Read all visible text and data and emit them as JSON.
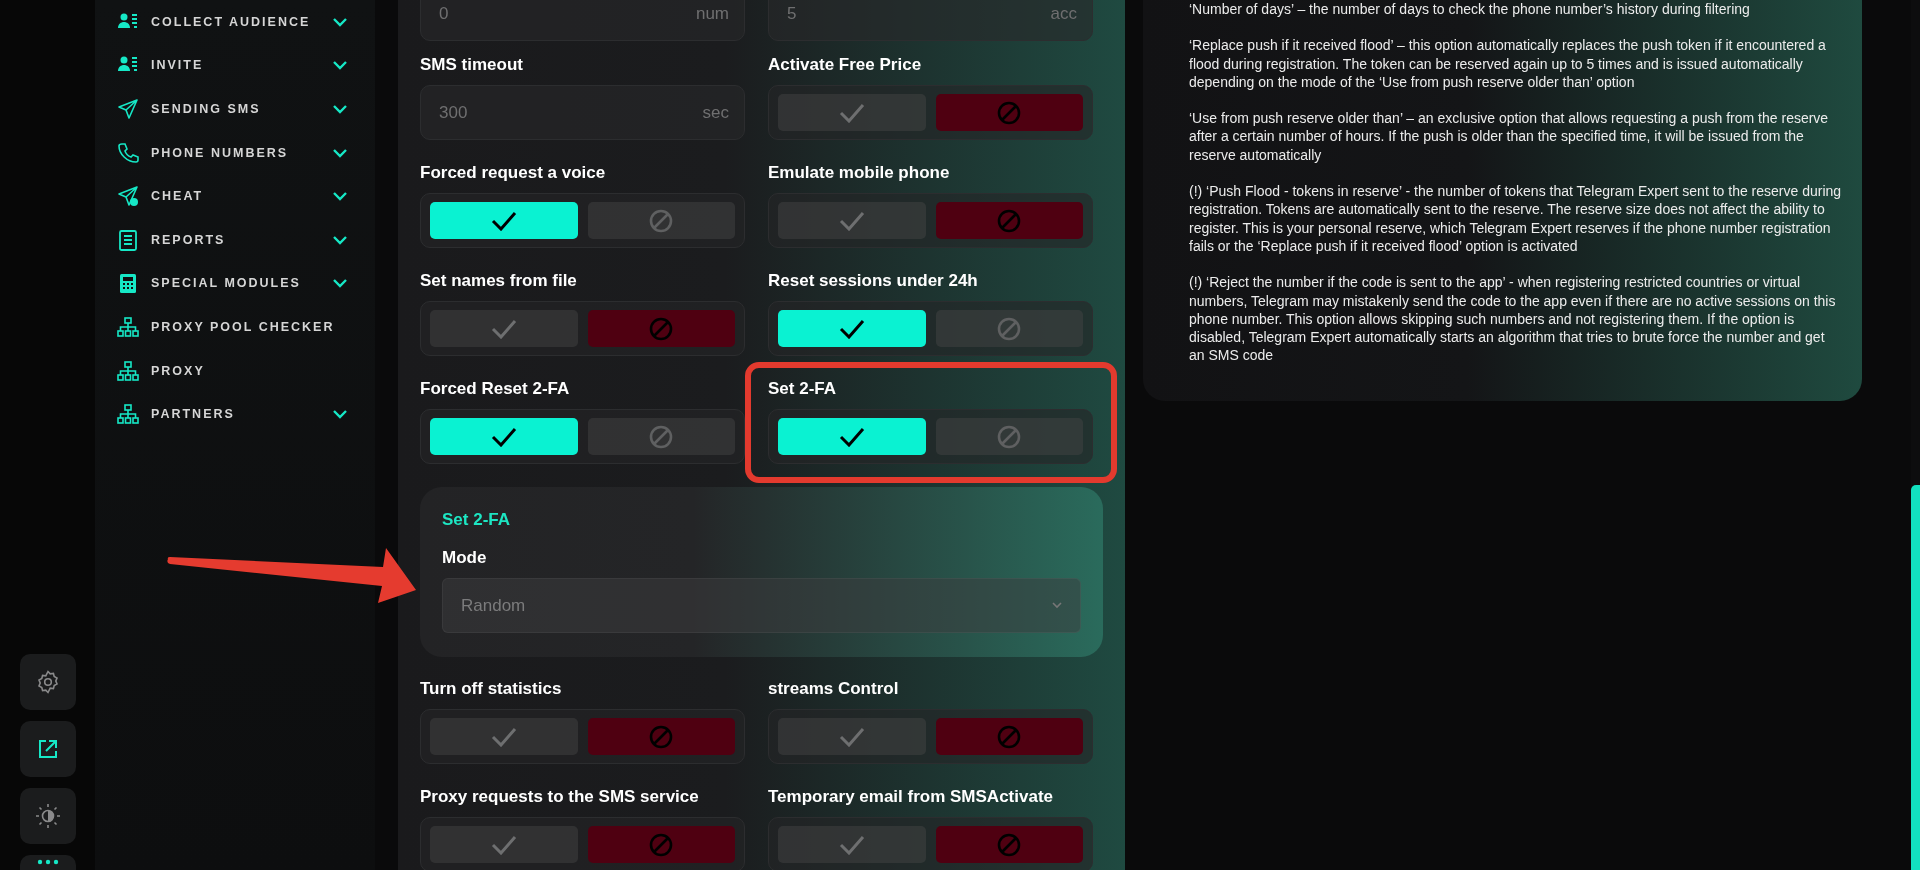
{
  "rail_buttons": [
    {
      "kind": "settings"
    },
    {
      "kind": "external"
    },
    {
      "kind": "theme"
    },
    {
      "kind": "more"
    }
  ],
  "sidebar": {
    "items": [
      {
        "label": "COLLECT AUDIENCE",
        "expandable": true
      },
      {
        "label": "INVITE",
        "expandable": true
      },
      {
        "label": "SENDING SMS",
        "expandable": true
      },
      {
        "label": "PHONE NUMBERS",
        "expandable": true
      },
      {
        "label": "CHEAT",
        "expandable": true
      },
      {
        "label": "REPORTS",
        "expandable": true
      },
      {
        "label": "SPECIAL MODULES",
        "expandable": true
      },
      {
        "label": "PROXY POOL CHECKER",
        "expandable": false
      },
      {
        "label": "PROXY",
        "expandable": false
      },
      {
        "label": "PARTNERS",
        "expandable": true
      }
    ]
  },
  "settings": [
    {
      "kind": "field",
      "placeholder": "0",
      "unit": "num"
    },
    {
      "kind": "field",
      "placeholder": "5",
      "unit": "acc"
    },
    {
      "kind": "field",
      "label": "SMS timeout",
      "placeholder": "300",
      "unit": "sec"
    },
    {
      "kind": "toggle",
      "label": "Activate Free Price",
      "on": false
    },
    {
      "kind": "toggle",
      "label": "Forced request a voice",
      "on": true
    },
    {
      "kind": "toggle",
      "label": "Emulate mobile phone",
      "on": false
    },
    {
      "kind": "toggle",
      "label": "Set names from file",
      "on": false
    },
    {
      "kind": "toggle",
      "label": "Reset sessions under 24h",
      "on": true
    },
    {
      "kind": "toggle",
      "label": "Forced Reset 2-FA",
      "on": true
    },
    {
      "kind": "toggle",
      "label": "Set 2-FA",
      "on": true
    }
  ],
  "set_2fa_panel": {
    "title": "Set 2-FA",
    "mode_label": "Mode",
    "mode_value": "Random"
  },
  "settings_more": [
    {
      "kind": "toggle",
      "label": "Turn off statistics",
      "on": false
    },
    {
      "kind": "toggle",
      "label": "streams Control",
      "on": false
    },
    {
      "kind": "toggle",
      "label": "Proxy requests to the SMS service",
      "on": false
    },
    {
      "kind": "toggle",
      "label": "Temporary email from SMSActivate",
      "on": false
    }
  ],
  "help_paragraphs": [
    "‘Number of days’ – the number of days to check the phone number’s history during filtering",
    "‘Replace push if it received flood’ – this option automatically replaces the push token if it encountered a flood during registration. The token can be reserved again up to 5 times and is issued automatically depending on the mode of the ‘Use from push reserve older than’ option",
    "‘Use from push reserve older than’ – an exclusive option that allows requesting a push from the reserve after a certain number of hours. If the push is older than the specified time, it will be issued from the reserve automatically",
    "(!) ‘Push Flood - tokens in reserve’ - the number of tokens that Telegram Expert sent to the reserve during registration. Tokens are automatically sent to the reserve. The reserve size does not affect the ability to register. This is your personal reserve, which Telegram Expert reserves if the phone number registration fails or the ‘Replace push if it received flood’ option is activated",
    "(!) ‘Reject the number if the code is sent to the app’ - when registering restricted countries or virtual numbers, Telegram may mistakenly send the code to the app even if there are no active sessions on this phone number. This option allows skipping such numbers and not registering them. If the option is disabled, Telegram Expert automatically starts an algorithm that tries to brute force the number and get an SMS code"
  ],
  "annotations": {
    "highlight_frame": true,
    "arrow": true
  }
}
